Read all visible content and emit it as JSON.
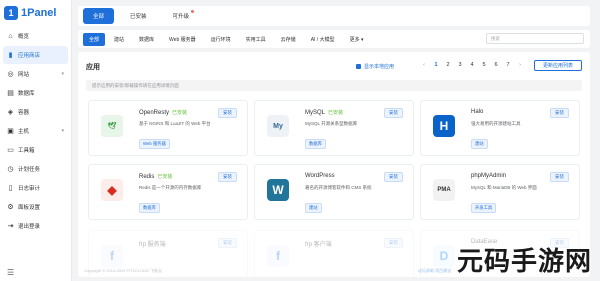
{
  "brand": {
    "name": "1Panel",
    "mark": "1"
  },
  "sidebar": {
    "items": [
      {
        "label": "概览",
        "icon": "home-icon",
        "glyph": "⌂",
        "active": false
      },
      {
        "label": "应用商店",
        "icon": "store-icon",
        "glyph": "▮",
        "active": true
      },
      {
        "label": "网站",
        "icon": "globe-icon",
        "glyph": "◎",
        "chev": "▾",
        "active": false
      },
      {
        "label": "数据库",
        "icon": "database-icon",
        "glyph": "▤",
        "active": false
      },
      {
        "label": "容器",
        "icon": "container-icon",
        "glyph": "◈",
        "active": false
      },
      {
        "label": "主机",
        "icon": "host-icon",
        "glyph": "▣",
        "chev": "▾",
        "active": false
      },
      {
        "label": "工具箱",
        "icon": "toolbox-icon",
        "glyph": "▭",
        "active": false
      },
      {
        "label": "计划任务",
        "icon": "clock-icon",
        "glyph": "◷",
        "active": false
      },
      {
        "label": "日志审计",
        "icon": "log-icon",
        "glyph": "▯",
        "active": false
      },
      {
        "label": "面板设置",
        "icon": "settings-icon",
        "glyph": "⚙",
        "active": false
      },
      {
        "label": "退出登录",
        "icon": "logout-icon",
        "glyph": "⇥",
        "active": false
      }
    ],
    "collapse_glyph": "☰"
  },
  "top_tabs": [
    {
      "label": "全部",
      "active": true
    },
    {
      "label": "已安装",
      "active": false
    },
    {
      "label": "可升级",
      "active": false,
      "dot": true
    }
  ],
  "categories": [
    {
      "label": "全部",
      "active": true
    },
    {
      "label": "建站"
    },
    {
      "label": "数据库"
    },
    {
      "label": "Web 服务器"
    },
    {
      "label": "运行环境"
    },
    {
      "label": "实用工具"
    },
    {
      "label": "云存储"
    },
    {
      "label": "AI / 大模型"
    },
    {
      "label": "更多 ▾"
    }
  ],
  "search": {
    "placeholder": "搜索"
  },
  "main": {
    "title": "应用",
    "show_local": "显示本地应用",
    "pages": [
      "‹",
      "1",
      "2",
      "3",
      "4",
      "5",
      "6",
      "7",
      "›"
    ],
    "current_page": "1",
    "update_button": "更新应用列表",
    "tip": "提示应用的安装/卸载操作请在应用详情页面"
  },
  "apps": [
    {
      "name": "OpenResty",
      "tag": "已安装",
      "desc": "基于 NGINX 和 LuaJIT 的 Web 平台",
      "badge": "Web 服务器",
      "install": "安装",
      "icon": "openresty-icon",
      "color": "#e8f5e9",
      "glyph": "🕊",
      "glyphColor": "#43a047"
    },
    {
      "name": "MySQL",
      "tag": "已安装",
      "desc": "MySQL 开源关系型数据库",
      "badge": "数据库",
      "install": "安装",
      "icon": "mysql-icon",
      "color": "#eef2f7",
      "glyph": "My",
      "glyphColor": "#2f6792"
    },
    {
      "name": "Halo",
      "tag": "",
      "desc": "强大易用的开源建站工具",
      "badge": "建站",
      "install": "安装",
      "icon": "halo-icon",
      "color": "#0a63c9",
      "glyph": "H",
      "glyphColor": "#ffffff"
    },
    {
      "name": "Redis",
      "tag": "已安装",
      "desc": "Redis 是一个开源的内存数据库",
      "badge": "数据库",
      "install": "安装",
      "icon": "redis-icon",
      "color": "#fdecea",
      "glyph": "◆",
      "glyphColor": "#d82c20"
    },
    {
      "name": "WordPress",
      "tag": "",
      "desc": "著名的开源博客软件和 CMS 系统",
      "badge": "建站",
      "install": "安装",
      "icon": "wordpress-icon",
      "color": "#21759b",
      "glyph": "W",
      "glyphColor": "#ffffff"
    },
    {
      "name": "phpMyAdmin",
      "tag": "",
      "desc": "MySQL 和 MariaDB 的 Web 界面",
      "badge": "开发工具",
      "install": "安装",
      "icon": "phpmyadmin-icon",
      "color": "#f2f2f2",
      "glyph": "PMA",
      "glyphColor": "#333333"
    },
    {
      "name": "frp 服务端",
      "tag": "",
      "desc": "",
      "badge": "",
      "install": "安装",
      "icon": "frp-icon",
      "color": "#f0f4ff",
      "glyph": "f",
      "glyphColor": "#3b82f6"
    },
    {
      "name": "frp 客户端",
      "tag": "",
      "desc": "",
      "badge": "",
      "install": "安装",
      "icon": "frp-client-icon",
      "color": "#f0f4ff",
      "glyph": "f",
      "glyphColor": "#3b82f6"
    },
    {
      "name": "DataEase",
      "tag": "",
      "desc": "",
      "badge": "",
      "install": "安装",
      "icon": "dataease-icon",
      "color": "#e6f7ff",
      "glyph": "D",
      "glyphColor": "#1890ff"
    }
  ],
  "footer": {
    "copyright": "Copyright © 2014-2024 FIT2CLOUD 飞致云",
    "links": "论坛求助    项目建议"
  },
  "watermark": "元码手游网"
}
